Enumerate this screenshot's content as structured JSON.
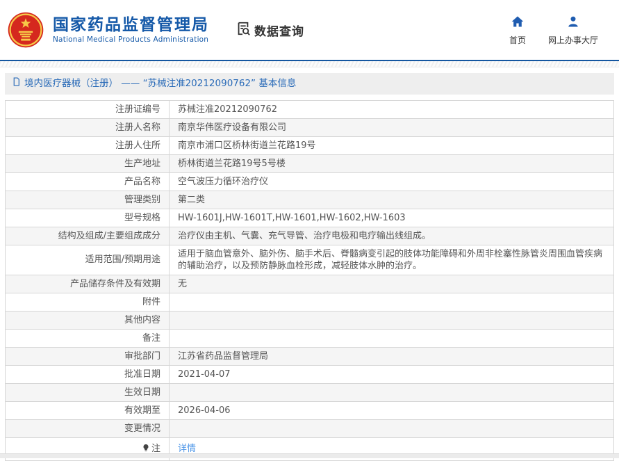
{
  "header": {
    "org_name_cn": "国家药品监督管理局",
    "org_name_en": "National Medical Products Administration",
    "section_title": "数据查询",
    "nav": [
      {
        "label": "首页",
        "icon": "home-icon"
      },
      {
        "label": "网上办事大厅",
        "icon": "user-icon"
      }
    ]
  },
  "breadcrumb": {
    "text": "境内医疗器械（注册） —— “苏械注准20212090762” 基本信息",
    "icon": "document-icon"
  },
  "table": {
    "rows": [
      {
        "label": "注册证编号",
        "value": "苏械注准20212090762"
      },
      {
        "label": "注册人名称",
        "value": "南京华伟医疗设备有限公司"
      },
      {
        "label": "注册人住所",
        "value": "南京市浦口区桥林街道兰花路19号"
      },
      {
        "label": "生产地址",
        "value": "桥林街道兰花路19号5号楼"
      },
      {
        "label": "产品名称",
        "value": "空气波压力循环治疗仪"
      },
      {
        "label": "管理类别",
        "value": "第二类"
      },
      {
        "label": "型号规格",
        "value": "HW-1601J,HW-1601T,HW-1601,HW-1602,HW-1603"
      },
      {
        "label": "结构及组成/主要组成成分",
        "value": "治疗仪由主机、气囊、充气导管、治疗电极和电疗输出线组成。"
      },
      {
        "label": "适用范围/预期用途",
        "value": "适用于脑血管意外、脑外伤、脑手术后、脊髓病变引起的肢体功能障碍和外周非栓塞性脉管炎周围血管疾病的辅助治疗，以及预防静脉血栓形成，减轻肢体水肿的治疗。"
      },
      {
        "label": "产品储存条件及有效期",
        "value": "无"
      },
      {
        "label": "附件",
        "value": ""
      },
      {
        "label": "其他内容",
        "value": ""
      },
      {
        "label": "备注",
        "value": ""
      },
      {
        "label": "审批部门",
        "value": "江苏省药品监督管理局"
      },
      {
        "label": "批准日期",
        "value": "2021-04-07"
      },
      {
        "label": "生效日期",
        "value": ""
      },
      {
        "label": "有效期至",
        "value": "2026-04-06"
      },
      {
        "label": "变更情况",
        "value": ""
      },
      {
        "label": "注",
        "value": "详情",
        "is_link": true,
        "icon": "bulb-icon"
      }
    ]
  },
  "colors": {
    "brand_blue": "#1559a8",
    "divider_blue": "#1456a0",
    "nav_icon_blue": "#1f5cb0",
    "breadcrumb_blue": "#2a6bb8",
    "link_blue": "#4f97e8",
    "emblem_red": "#d5281e",
    "emblem_gold": "#f7c948",
    "row_alt_gray": "#f5f5f5",
    "border_gray": "#d6d6d6"
  }
}
